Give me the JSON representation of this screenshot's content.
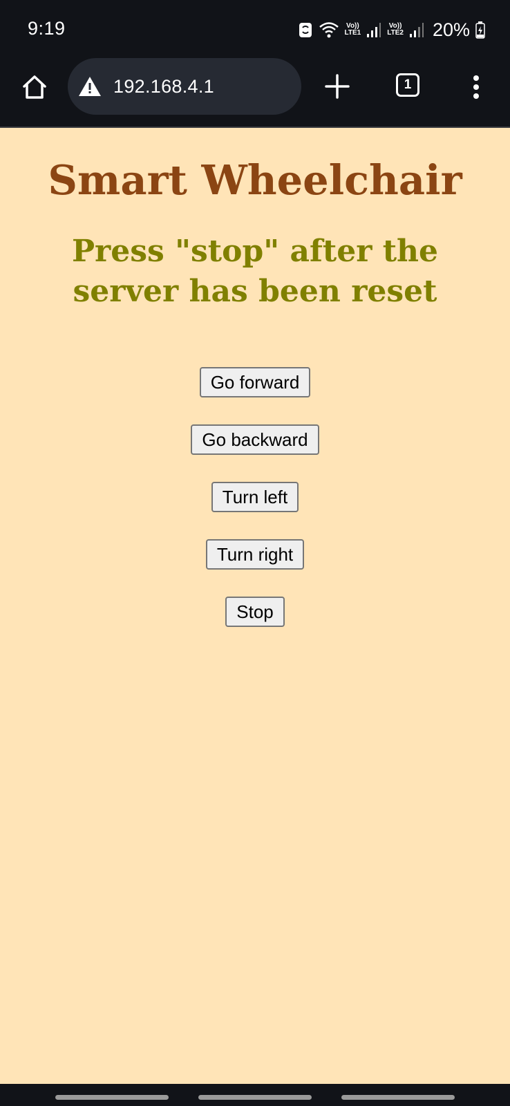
{
  "status_bar": {
    "time": "9:19",
    "sim1_label_top": "Vo))",
    "sim1_label_bottom": "LTE1",
    "sim2_label_top": "Vo))",
    "sim2_label_bottom": "LTE2",
    "battery": "20%",
    "icons": [
      "sync-icon",
      "wifi-icon",
      "signal-icon",
      "signal-icon",
      "battery-charging-icon"
    ]
  },
  "browser": {
    "url": "192.168.4.1",
    "tab_count": "1",
    "icons": [
      "home-icon",
      "warning-icon",
      "plus-icon",
      "tabs-icon",
      "overflow-menu-icon"
    ]
  },
  "page": {
    "title": "Smart Wheelchair",
    "subtitle": "Press \"stop\" after the server has been reset",
    "buttons": [
      {
        "label": "Go forward"
      },
      {
        "label": "Go backward"
      },
      {
        "label": "Turn left"
      },
      {
        "label": "Turn right"
      },
      {
        "label": "Stop"
      }
    ]
  },
  "colors": {
    "background": "#FFE4B7",
    "title": "#8B4513",
    "subtitle": "#808000",
    "chrome": "#111318",
    "url_pill": "#262a33"
  }
}
